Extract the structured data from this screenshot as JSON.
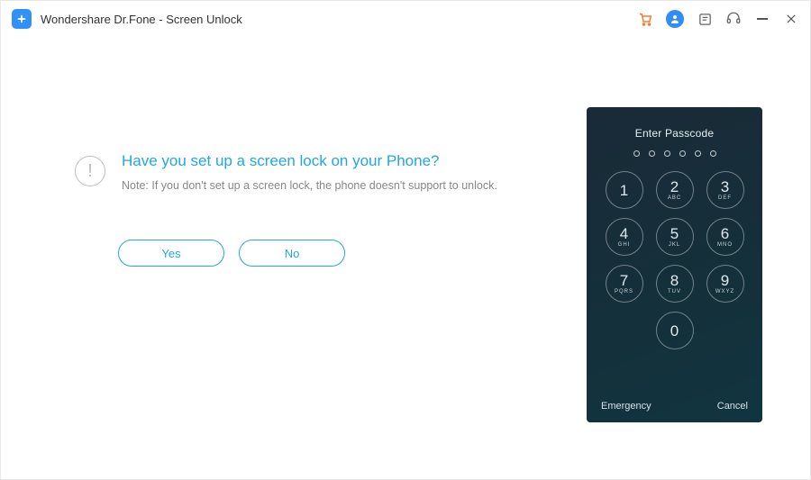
{
  "window": {
    "title": "Wondershare Dr.Fone - Screen Unlock"
  },
  "titlebar_icons": {
    "cart": "cart",
    "user": "user",
    "feedback": "feedback",
    "support": "support",
    "minimize": "minimize",
    "close": "close"
  },
  "prompt": {
    "question": "Have you set up a screen lock on your Phone?",
    "note": "Note: If you don't set up a screen lock, the phone doesn't support to unlock.",
    "yes_label": "Yes",
    "no_label": "No",
    "info_glyph": "!"
  },
  "phone": {
    "title": "Enter Passcode",
    "passcode_length": 6,
    "keys": [
      {
        "digit": "1",
        "letters": ""
      },
      {
        "digit": "2",
        "letters": "ABC"
      },
      {
        "digit": "3",
        "letters": "DEF"
      },
      {
        "digit": "4",
        "letters": "GHI"
      },
      {
        "digit": "5",
        "letters": "JKL"
      },
      {
        "digit": "6",
        "letters": "MNO"
      },
      {
        "digit": "7",
        "letters": "PQRS"
      },
      {
        "digit": "8",
        "letters": "TUV"
      },
      {
        "digit": "9",
        "letters": "WXYZ"
      },
      {
        "digit": "0",
        "letters": ""
      }
    ],
    "emergency_label": "Emergency",
    "cancel_label": "Cancel"
  }
}
